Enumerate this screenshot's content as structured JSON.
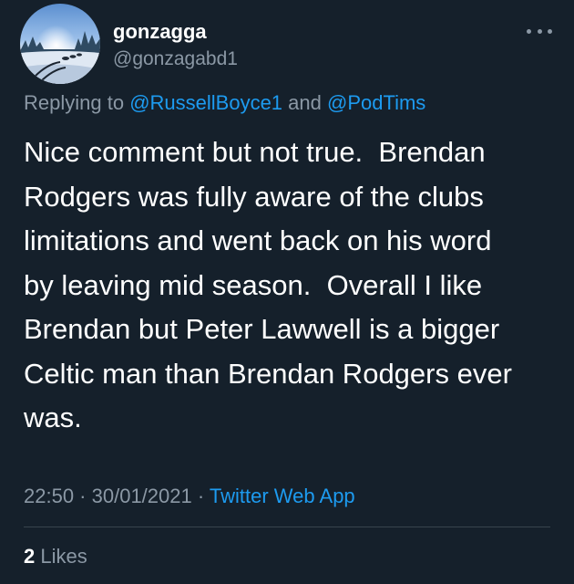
{
  "author": {
    "display_name": "gonzagga",
    "handle": "@gonzagabd1",
    "avatar_icon": "winter-sled-dogs-avatar"
  },
  "more_icon": "more-horizontal-icon",
  "reply_context": {
    "prefix": "Replying to ",
    "mention_1": "@RussellBoyce1",
    "joiner": " and ",
    "mention_2": "@PodTims"
  },
  "tweet": {
    "text": "Nice comment but not true.  Brendan\nRodgers was fully aware of the clubs\nlimitations and went back on his word\nby leaving mid season.  Overall I like\nBrendan but Peter Lawwell is a bigger\nCeltic man than Brendan Rodgers ever\nwas."
  },
  "meta": {
    "time": "22:50",
    "separator": " · ",
    "date": "30/01/2021",
    "separator_2": " · ",
    "source": "Twitter Web App"
  },
  "engagement": {
    "likes_count": "2",
    "likes_label": " Likes"
  },
  "colors": {
    "background": "#15202b",
    "primary_text": "#ffffff",
    "secondary_text": "#8b98a5",
    "accent": "#1d9bf0",
    "divider": "#38444d"
  }
}
